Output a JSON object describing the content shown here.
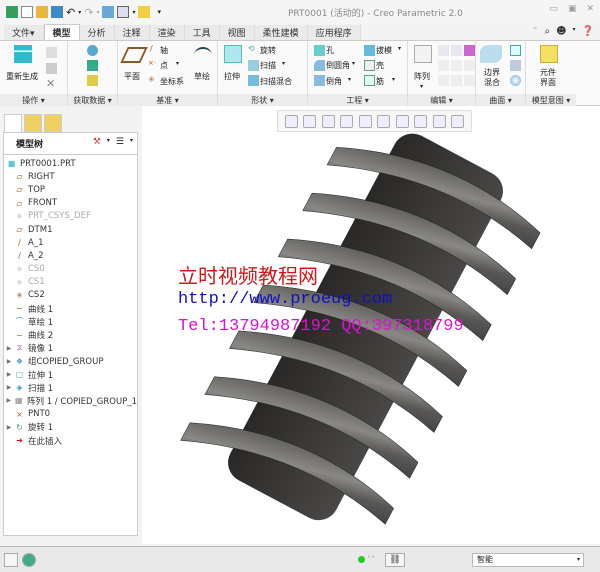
{
  "window": {
    "title": "PRT0001 (活动的) - Creo Parametric 2.0"
  },
  "menu_tabs": [
    {
      "label": "文件▾"
    },
    {
      "label": "模型",
      "active": true
    },
    {
      "label": "分析"
    },
    {
      "label": "注释"
    },
    {
      "label": "渲染"
    },
    {
      "label": "工具"
    },
    {
      "label": "视图"
    },
    {
      "label": "柔性建模"
    },
    {
      "label": "应用程序"
    }
  ],
  "ribbon": {
    "groups": {
      "operations": "操作 ▾",
      "get_data": "获取数据 ▾",
      "datum": "基准 ▾",
      "shapes": "形状 ▾",
      "engineering": "工程 ▾",
      "editing": "编辑 ▾",
      "surfaces": "曲面 ▾",
      "model_intent": "模型意图 ▾"
    },
    "buttons": {
      "regenerate": "重新生成",
      "plane": "平面",
      "axis": "轴",
      "point": "点",
      "csys": "坐标系",
      "sketch": "草绘",
      "extrude": "拉伸",
      "revolve": "旋转",
      "sweep": "扫描",
      "swept_blend": "扫描混合",
      "hole": "孔",
      "round": "倒圆角",
      "chamfer": "倒角",
      "draft": "拔模",
      "shell": "壳",
      "rib": "筋",
      "pattern": "阵列",
      "boundary_blend_1": "边界",
      "boundary_blend_2": "混合",
      "component_interface_1": "元件",
      "component_interface_2": "界面"
    }
  },
  "model_tree": {
    "header": "模型树",
    "items": [
      {
        "label": "PRT0001.PRT",
        "icon": "part-icon",
        "expandable": false,
        "dim": false,
        "indent": 0
      },
      {
        "label": "RIGHT",
        "icon": "datum-plane-icon",
        "expandable": false,
        "dim": false,
        "indent": 1
      },
      {
        "label": "TOP",
        "icon": "datum-plane-icon",
        "expandable": false,
        "dim": false,
        "indent": 1
      },
      {
        "label": "FRONT",
        "icon": "datum-plane-icon",
        "expandable": false,
        "dim": false,
        "indent": 1
      },
      {
        "label": "PRT_CSYS_DEF",
        "icon": "csys-icon",
        "expandable": false,
        "dim": true,
        "indent": 1
      },
      {
        "label": "DTM1",
        "icon": "datum-plane-icon",
        "expandable": false,
        "dim": false,
        "indent": 1
      },
      {
        "label": "A_1",
        "icon": "axis-icon",
        "expandable": false,
        "dim": false,
        "indent": 1
      },
      {
        "label": "A_2",
        "icon": "axis-icon",
        "expandable": false,
        "dim": false,
        "indent": 1
      },
      {
        "label": "CS0",
        "icon": "csys-icon",
        "expandable": false,
        "dim": true,
        "indent": 1
      },
      {
        "label": "CS1",
        "icon": "csys-icon",
        "expandable": false,
        "dim": true,
        "indent": 1
      },
      {
        "label": "CS2",
        "icon": "csys-icon",
        "expandable": false,
        "dim": false,
        "indent": 1
      },
      {
        "label": "曲线 1",
        "icon": "curve-icon",
        "expandable": false,
        "dim": false,
        "indent": 1
      },
      {
        "label": "草绘 1",
        "icon": "sketch-icon",
        "expandable": false,
        "dim": false,
        "indent": 1
      },
      {
        "label": "曲线 2",
        "icon": "curve-icon",
        "expandable": false,
        "dim": false,
        "indent": 1
      },
      {
        "label": "镜像 1",
        "icon": "mirror-icon",
        "expandable": true,
        "dim": false,
        "indent": 1
      },
      {
        "label": "组COPIED_GROUP",
        "icon": "group-icon",
        "expandable": true,
        "dim": false,
        "indent": 1
      },
      {
        "label": "拉伸 1",
        "icon": "extrude-icon",
        "expandable": true,
        "dim": false,
        "indent": 1
      },
      {
        "label": "扫描 1",
        "icon": "sweep-icon",
        "expandable": true,
        "dim": false,
        "indent": 1
      },
      {
        "label": "阵列 1 / COPIED_GROUP_1",
        "icon": "pattern-icon",
        "expandable": true,
        "dim": false,
        "indent": 1
      },
      {
        "label": "PNT0",
        "icon": "point-icon",
        "expandable": false,
        "dim": false,
        "indent": 1
      },
      {
        "label": "旋转 1",
        "icon": "revolve-icon",
        "expandable": true,
        "dim": false,
        "indent": 1
      },
      {
        "label": "在此插入",
        "icon": "insert-here-icon",
        "expandable": false,
        "dim": false,
        "indent": 1
      }
    ]
  },
  "watermark": {
    "line1": "立时视频教程网",
    "line2": "http://www.proeug.com",
    "line3": "Tel:13794987192  QQ:397318799"
  },
  "status": {
    "filter": "智能"
  },
  "colors": {
    "accent": "#2a6cc4",
    "watermark_red": "#d01818",
    "watermark_blue": "#1010c0",
    "watermark_magenta": "#e010d0",
    "model_gray": "#4a4846"
  }
}
